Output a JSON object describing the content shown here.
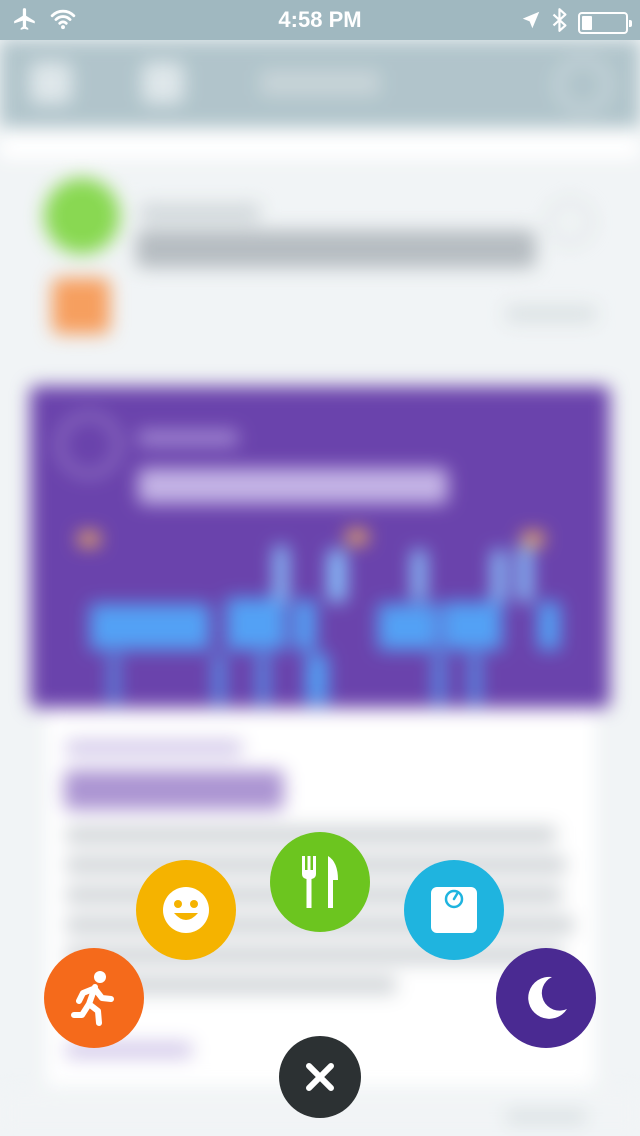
{
  "status_bar": {
    "time": "4:58 PM"
  },
  "icons": {
    "airplane": "airplane-icon",
    "wifi": "wifi-icon",
    "location": "location-arrow-icon",
    "bluetooth": "bluetooth-icon",
    "battery": "battery-icon"
  },
  "action_menu": {
    "buttons": [
      {
        "name": "activity",
        "icon": "running-person-icon",
        "color": "#f56a1b"
      },
      {
        "name": "mood",
        "icon": "smiley-face-icon",
        "color": "#f5b300"
      },
      {
        "name": "food",
        "icon": "fork-knife-icon",
        "color": "#6cc51f"
      },
      {
        "name": "weight",
        "icon": "scale-icon",
        "color": "#1fb4df"
      },
      {
        "name": "sleep",
        "icon": "moon-icon",
        "color": "#4a2a92"
      }
    ],
    "close": {
      "icon": "close-icon",
      "color": "#2c3133"
    }
  }
}
